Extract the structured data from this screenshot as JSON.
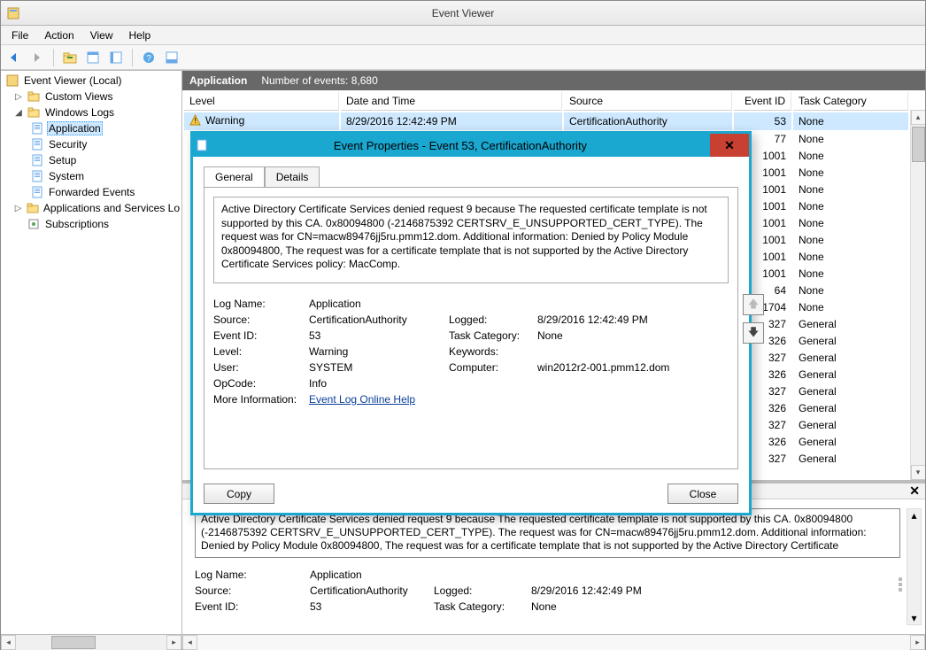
{
  "window": {
    "title": "Event Viewer"
  },
  "menu": {
    "file": "File",
    "action": "Action",
    "view": "View",
    "help": "Help"
  },
  "header": {
    "title": "Application",
    "count_label": "Number of events: 8,680"
  },
  "columns": {
    "level": "Level",
    "date": "Date and Time",
    "source": "Source",
    "event_id": "Event ID",
    "task_cat": "Task Category"
  },
  "tree": {
    "root": "Event Viewer (Local)",
    "custom_views": "Custom Views",
    "windows_logs": "Windows Logs",
    "application": "Application",
    "security": "Security",
    "setup": "Setup",
    "system": "System",
    "forwarded": "Forwarded Events",
    "apps_services": "Applications and Services Lo",
    "subscriptions": "Subscriptions"
  },
  "events": [
    {
      "level": "Warning",
      "date": "8/29/2016 12:42:49 PM",
      "source": "CertificationAuthority",
      "id": "53",
      "cat": "None"
    },
    {
      "level": "",
      "date": "",
      "source": "",
      "id": "77",
      "cat": "None"
    },
    {
      "level": "",
      "date": "",
      "source": "",
      "id": "1001",
      "cat": "None"
    },
    {
      "level": "",
      "date": "",
      "source": "",
      "id": "1001",
      "cat": "None"
    },
    {
      "level": "",
      "date": "",
      "source": "",
      "id": "1001",
      "cat": "None"
    },
    {
      "level": "",
      "date": "",
      "source": "",
      "id": "1001",
      "cat": "None"
    },
    {
      "level": "",
      "date": "",
      "source": "",
      "id": "1001",
      "cat": "None"
    },
    {
      "level": "",
      "date": "",
      "source": "",
      "id": "1001",
      "cat": "None"
    },
    {
      "level": "",
      "date": "",
      "source": "",
      "id": "1001",
      "cat": "None"
    },
    {
      "level": "",
      "date": "",
      "source": "",
      "id": "1001",
      "cat": "None"
    },
    {
      "level": "",
      "date": "",
      "source": "",
      "id": "64",
      "cat": "None"
    },
    {
      "level": "",
      "date": "",
      "source": "",
      "id": "1704",
      "cat": "None"
    },
    {
      "level": "",
      "date": "",
      "source": "",
      "id": "327",
      "cat": "General"
    },
    {
      "level": "",
      "date": "",
      "source": "",
      "id": "326",
      "cat": "General"
    },
    {
      "level": "",
      "date": "",
      "source": "",
      "id": "327",
      "cat": "General"
    },
    {
      "level": "",
      "date": "",
      "source": "",
      "id": "326",
      "cat": "General"
    },
    {
      "level": "",
      "date": "",
      "source": "",
      "id": "327",
      "cat": "General"
    },
    {
      "level": "",
      "date": "",
      "source": "",
      "id": "326",
      "cat": "General"
    },
    {
      "level": "",
      "date": "",
      "source": "",
      "id": "327",
      "cat": "General"
    },
    {
      "level": "",
      "date": "",
      "source": "",
      "id": "326",
      "cat": "General"
    },
    {
      "level": "",
      "date": "",
      "source": "",
      "id": "327",
      "cat": "General"
    }
  ],
  "detail": {
    "description": "Active Directory Certificate Services denied request 9 because The requested certificate template is not supported by this CA. 0x80094800 (-2146875392 CERTSRV_E_UNSUPPORTED_CERT_TYPE).  The request was for CN=macw89476jj5ru.pmm12.dom.  Additional information: Denied by Policy Module  0x80094800, The request was for a certificate template that is not supported by the Active Directory Certificate Services policy: MacComp.",
    "description_bottom": "Active Directory Certificate Services denied request 9 because The requested certificate template is not supported by this CA. 0x80094800 (-2146875392 CERTSRV_E_UNSUPPORTED_CERT_TYPE).  The request was for CN=macw89476jj5ru.pmm12.dom.  Additional information: Denied by Policy Module  0x80094800, The request was for a certificate template that is not supported by the Active Directory Certificate",
    "labels": {
      "log_name": "Log Name:",
      "source": "Source:",
      "event_id": "Event ID:",
      "level": "Level:",
      "user": "User:",
      "opcode": "OpCode:",
      "more_info": "More Information:",
      "logged": "Logged:",
      "task_cat": "Task Category:",
      "keywords": "Keywords:",
      "computer": "Computer:"
    },
    "values": {
      "log_name": "Application",
      "source": "CertificationAuthority",
      "event_id": "53",
      "level": "Warning",
      "user": "SYSTEM",
      "opcode": "Info",
      "more_info": "Event Log Online Help",
      "logged": "8/29/2016 12:42:49 PM",
      "task_cat": "None",
      "keywords": "",
      "computer": "win2012r2-001.pmm12.dom"
    }
  },
  "modal": {
    "title": "Event Properties - Event 53, CertificationAuthority",
    "tabs": {
      "general": "General",
      "details": "Details"
    },
    "buttons": {
      "copy": "Copy",
      "close": "Close"
    }
  }
}
